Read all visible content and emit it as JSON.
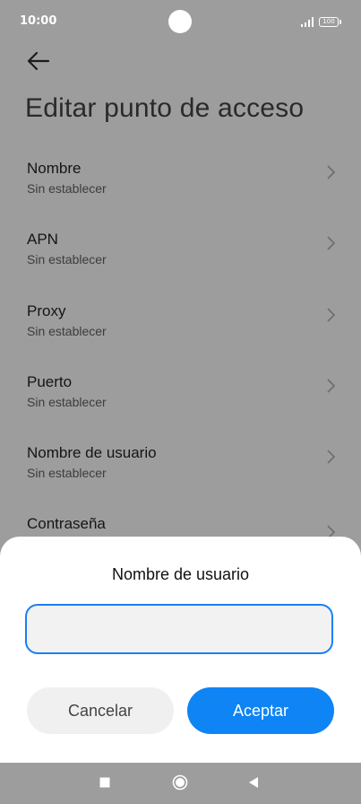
{
  "status_bar": {
    "time": "10:00",
    "battery": "100"
  },
  "page": {
    "title": "Editar punto de acceso"
  },
  "settings": {
    "items": [
      {
        "label": "Nombre",
        "value": "Sin establecer"
      },
      {
        "label": "APN",
        "value": "Sin establecer"
      },
      {
        "label": "Proxy",
        "value": "Sin establecer"
      },
      {
        "label": "Puerto",
        "value": "Sin establecer"
      },
      {
        "label": "Nombre de usuario",
        "value": "Sin establecer"
      },
      {
        "label": "Contraseña",
        "value": ""
      }
    ]
  },
  "dialog": {
    "title": "Nombre de usuario",
    "input_value": "",
    "cancel_label": "Cancelar",
    "ok_label": "Aceptar"
  },
  "colors": {
    "accent": "#0e84f5",
    "overlay": "#9d9d9d",
    "sheet": "#ffffff"
  },
  "icons": {
    "back": "arrow-left-icon",
    "chevron": "chevron-right-icon",
    "nav_recents": "square-icon",
    "nav_home": "circle-icon",
    "nav_back": "triangle-left-icon"
  }
}
